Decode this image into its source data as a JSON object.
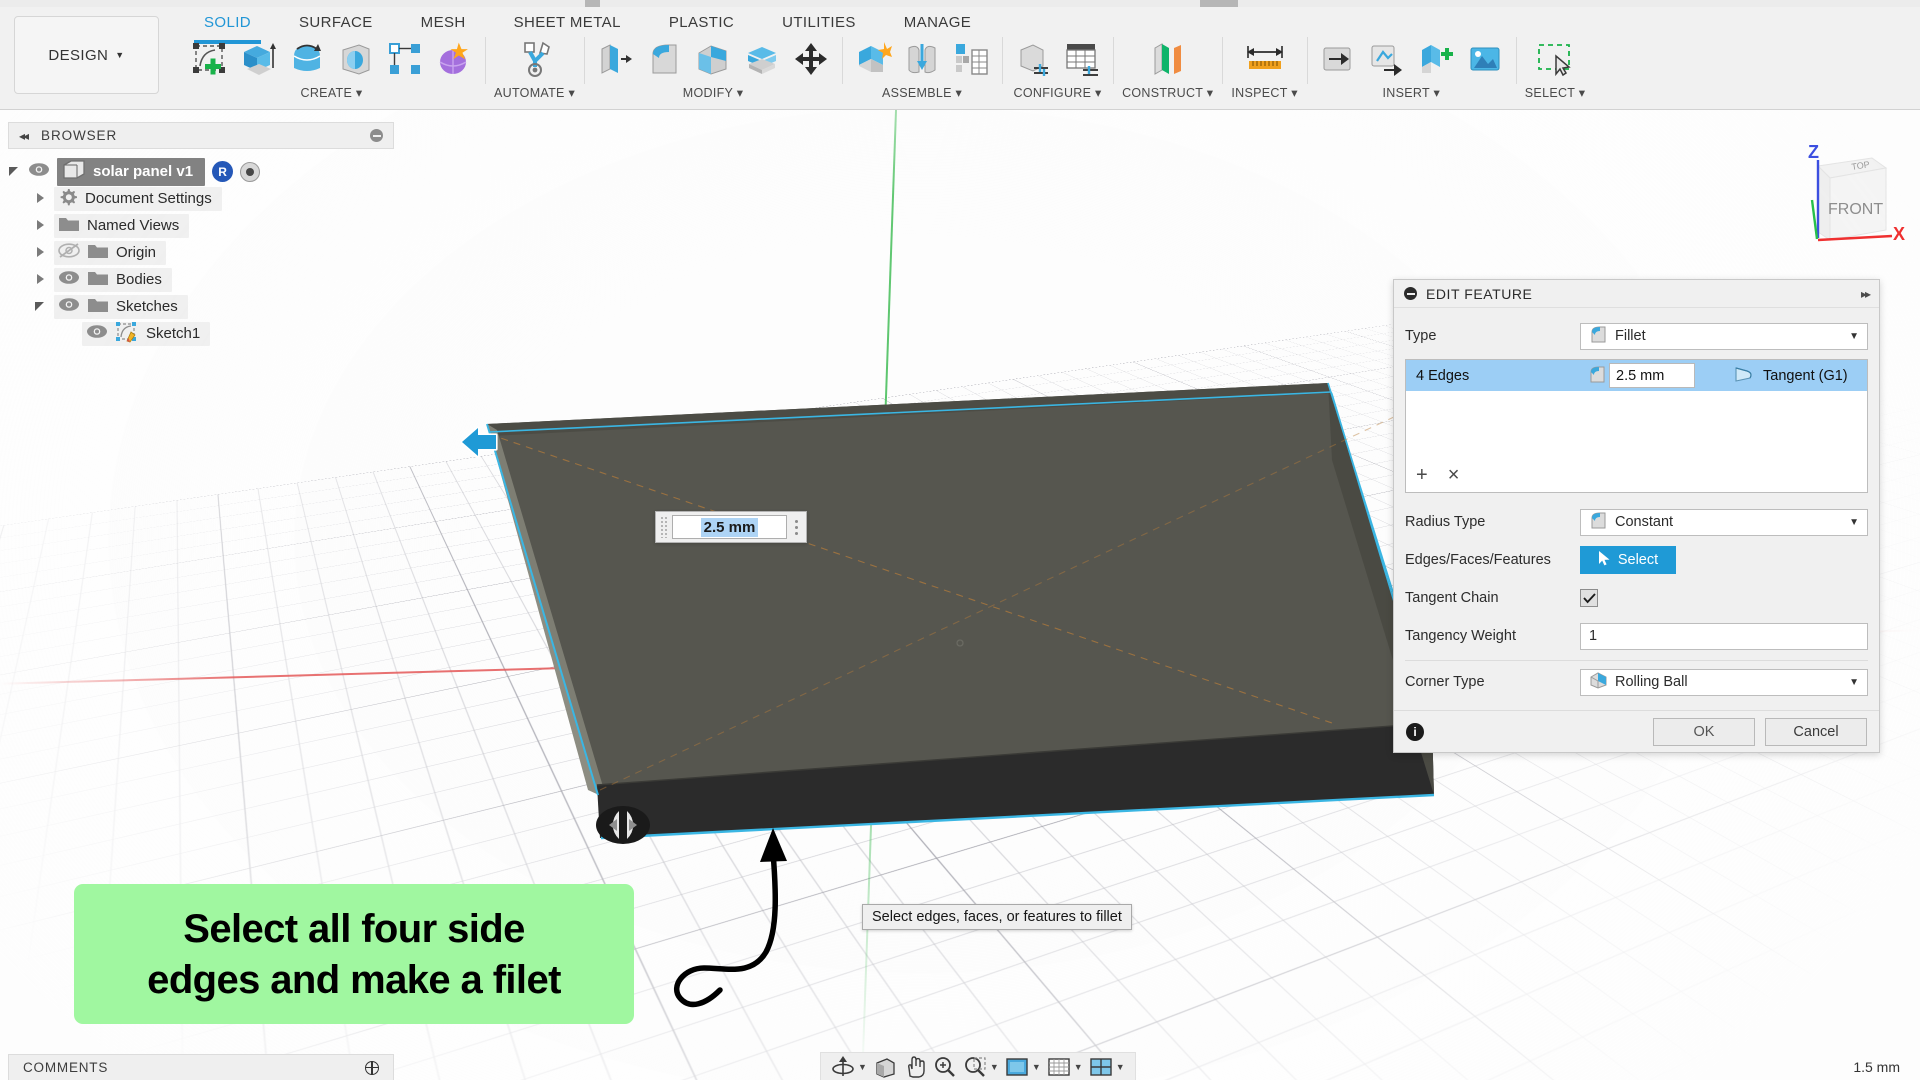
{
  "app": {
    "workspace_label": "DESIGN",
    "tabs": [
      {
        "label": "SOLID",
        "active": true
      },
      {
        "label": "SURFACE",
        "active": false
      },
      {
        "label": "MESH",
        "active": false
      },
      {
        "label": "SHEET METAL",
        "active": false
      },
      {
        "label": "PLASTIC",
        "active": false
      },
      {
        "label": "UTILITIES",
        "active": false
      },
      {
        "label": "MANAGE",
        "active": false
      }
    ],
    "ribbon_groups": [
      {
        "label": "CREATE",
        "icons": [
          "new-sketch-icon",
          "extrude-icon",
          "revolve-icon",
          "sweep-icon",
          "pattern-icon",
          "form-icon"
        ]
      },
      {
        "label": "AUTOMATE",
        "icons": [
          "automate-icon"
        ]
      },
      {
        "label": "MODIFY",
        "icons": [
          "press-pull-icon",
          "fillet-icon",
          "chamfer-icon",
          "shell-icon",
          "combine-icon",
          "offset-face-icon",
          "move-copy-icon"
        ]
      },
      {
        "label": "ASSEMBLE",
        "icons": [
          "new-component-icon",
          "joint-icon",
          "bom-icon"
        ]
      },
      {
        "label": "CONFIGURE",
        "icons": [
          "configuration-icon",
          "configuration-table-icon"
        ]
      },
      {
        "label": "CONSTRUCT",
        "icons": [
          "offset-plane-icon"
        ]
      },
      {
        "label": "INSPECT",
        "icons": [
          "measure-icon"
        ]
      },
      {
        "label": "INSERT",
        "icons": [
          "derive-icon",
          "insert-mcmaster-icon",
          "insert-mesh-icon",
          "decal-icon"
        ]
      },
      {
        "label": "SELECT",
        "icons": [
          "select-icon"
        ]
      }
    ]
  },
  "browser": {
    "title": "BROWSER",
    "collapse_glyph": "◂◂",
    "root": {
      "label": "solar panel v1",
      "badge": "R",
      "visible": true
    },
    "items": [
      {
        "label": "Document Settings",
        "icon": "gear-icon",
        "visible": true,
        "expanded": false,
        "indent": 1
      },
      {
        "label": "Named Views",
        "icon": "folder-icon",
        "visible": true,
        "expanded": false,
        "indent": 1
      },
      {
        "label": "Origin",
        "icon": "folder-icon",
        "visible": false,
        "expanded": false,
        "indent": 1
      },
      {
        "label": "Bodies",
        "icon": "folder-icon",
        "visible": true,
        "expanded": false,
        "indent": 1
      },
      {
        "label": "Sketches",
        "icon": "folder-icon",
        "visible": true,
        "expanded": true,
        "indent": 1
      },
      {
        "label": "Sketch1",
        "icon": "sketch-icon",
        "visible": true,
        "expanded": null,
        "indent": 2
      }
    ]
  },
  "dialog": {
    "title": "EDIT FEATURE",
    "expand_glyph": "▸▸",
    "rows": {
      "type_label": "Type",
      "type_value": "Fillet",
      "radius_type_label": "Radius Type",
      "radius_type_value": "Constant",
      "edges_label": "Edges/Faces/Features",
      "select_button": "Select",
      "tangent_chain_label": "Tangent Chain",
      "tangent_chain_checked": true,
      "tangency_weight_label": "Tangency Weight",
      "tangency_weight_value": "1",
      "corner_type_label": "Corner Type",
      "corner_type_value": "Rolling Ball"
    },
    "edge_list": [
      {
        "name": "4 Edges",
        "radius": "2.5 mm",
        "continuity": "Tangent (G1)",
        "selected": true
      }
    ],
    "list_tools": {
      "add": "+",
      "remove": "×"
    },
    "footer": {
      "ok": "OK",
      "cancel": "Cancel",
      "info": "i"
    }
  },
  "viewport": {
    "value_field": {
      "value": "2.5 mm"
    },
    "tooltip": "Select edges, faces, or features to fillet",
    "callout": {
      "line1": "Select all four side",
      "line2": "edges and make a filet",
      "background": "#a0f7a0"
    },
    "viewcube": {
      "top": "TOP",
      "front": "FRONT",
      "axis_z": "Z",
      "axis_x": "X"
    }
  },
  "statusbar": {
    "comments_label": "COMMENTS",
    "scale_value": "1.5 mm",
    "nav_icons": [
      "orbit-icon",
      "look-at-icon",
      "pan-icon",
      "zoom-icon",
      "zoom-window-icon",
      "display-settings-icon",
      "grid-snap-icon",
      "viewports-icon"
    ]
  },
  "colors": {
    "accent_blue": "#2196d6",
    "select_blue": "#1f9ad6",
    "highlight_row": "#9ccef5",
    "edge_highlight": "#2eb3e0",
    "callout_green": "#a0f7a0",
    "body_grey": "#56564f",
    "body_dark": "#2b2b2b"
  }
}
